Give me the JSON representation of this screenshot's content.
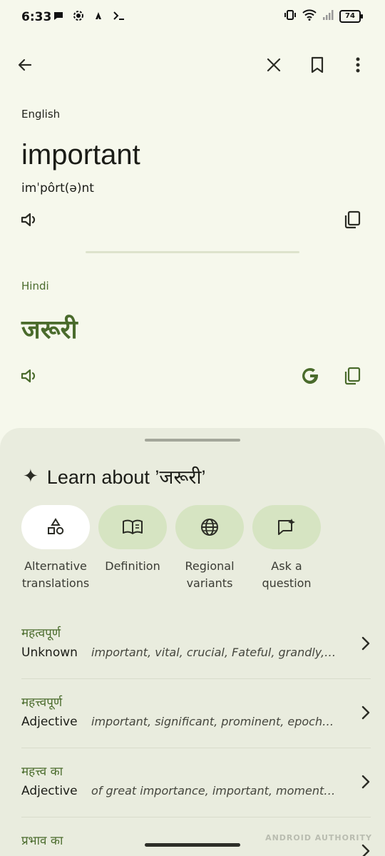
{
  "status_bar": {
    "time": "6:33",
    "battery": "74"
  },
  "source": {
    "language": "English",
    "word": "important",
    "pronunciation": "imˈpôrt(ə)nt"
  },
  "target": {
    "language": "Hindi",
    "word": "जरूरी"
  },
  "learn": {
    "title": "Learn about ’जरूरी’",
    "chips": [
      {
        "label": "Alternative\ntranslations",
        "icon": "shapes-icon",
        "selected": true
      },
      {
        "label": "Definition",
        "icon": "book-icon",
        "selected": false
      },
      {
        "label": "Regional\nvariants",
        "icon": "globe-icon",
        "selected": false
      },
      {
        "label": "Ask a\nquestion",
        "icon": "chat-sparkle-icon",
        "selected": false
      }
    ]
  },
  "alternatives": [
    {
      "word": "महत्वपूर्ण",
      "pos": "Unknown",
      "translations": "important, vital, crucial, Fateful, grandly, o..."
    },
    {
      "word": "महत्त्वपूर्ण",
      "pos": "Adjective",
      "translations": "important, significant, prominent, epochal,..."
    },
    {
      "word": "महत्त्व का",
      "pos": "Adjective",
      "translations": "of great importance, important, momento..."
    },
    {
      "word": "प्रभाव का",
      "pos": "",
      "translations": ""
    }
  ],
  "watermark": "ANDROID AUTHORITY",
  "colors": {
    "background": "#f6f8ec",
    "accent_green": "#4a6b2c",
    "chip_bg": "#d6e4c2",
    "sheet_bg": "#e9ecde"
  }
}
